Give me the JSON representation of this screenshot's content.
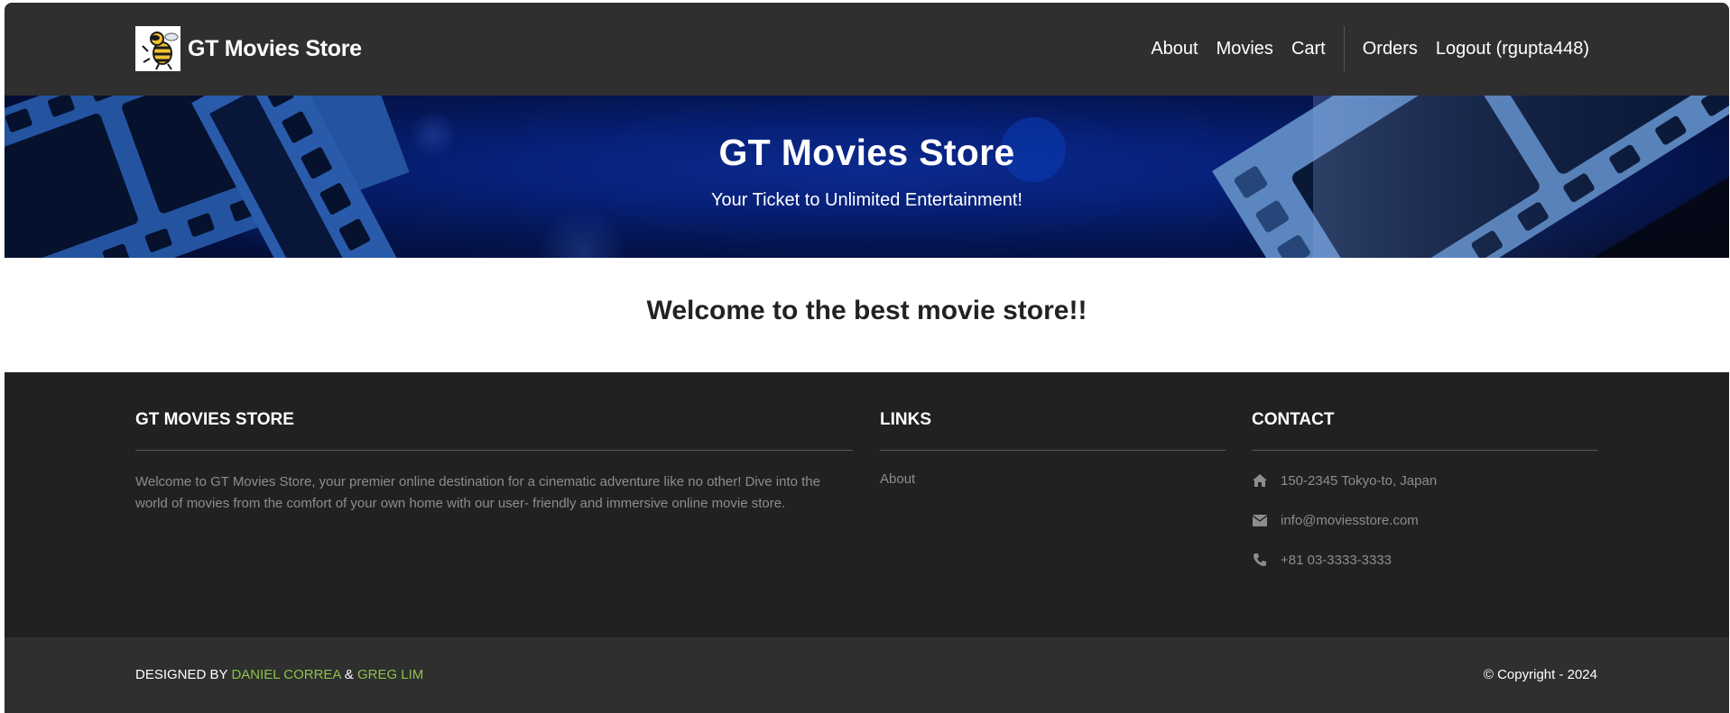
{
  "navbar": {
    "brand": "GT Movies Store",
    "links": {
      "about": "About",
      "movies": "Movies",
      "cart": "Cart",
      "orders": "Orders",
      "logout": "Logout (rgupta448)"
    }
  },
  "hero": {
    "title": "GT Movies Store",
    "subtitle": "Your Ticket to Unlimited Entertainment!"
  },
  "welcome": {
    "text": "Welcome to the best movie store!!"
  },
  "footer": {
    "about": {
      "heading": "GT MOVIES STORE",
      "text": "Welcome to GT Movies Store, your premier online destination for a cinematic adventure like no other! Dive into the world of movies from the comfort of your own home with our user- friendly and immersive online movie store."
    },
    "links": {
      "heading": "LINKS",
      "items": [
        "About"
      ]
    },
    "contact": {
      "heading": "CONTACT",
      "address": "150-2345 Tokyo-to, Japan",
      "email": "info@moviesstore.com",
      "phone": "+81 03-3333-3333"
    }
  },
  "bottom": {
    "designed_prefix": "DESIGNED BY",
    "designer1": "DANIEL CORREA",
    "ampersand": "&",
    "designer2": "GREG LIM",
    "copyright": "© Copyright - 2024"
  },
  "colors": {
    "navbar_bg": "#2f2f2f",
    "footer_bg": "#212121",
    "accent_green": "#8bc34a",
    "hero_blue": "#07217a"
  },
  "icons": {
    "address": "home-icon",
    "email": "envelope-icon",
    "phone": "phone-icon"
  }
}
